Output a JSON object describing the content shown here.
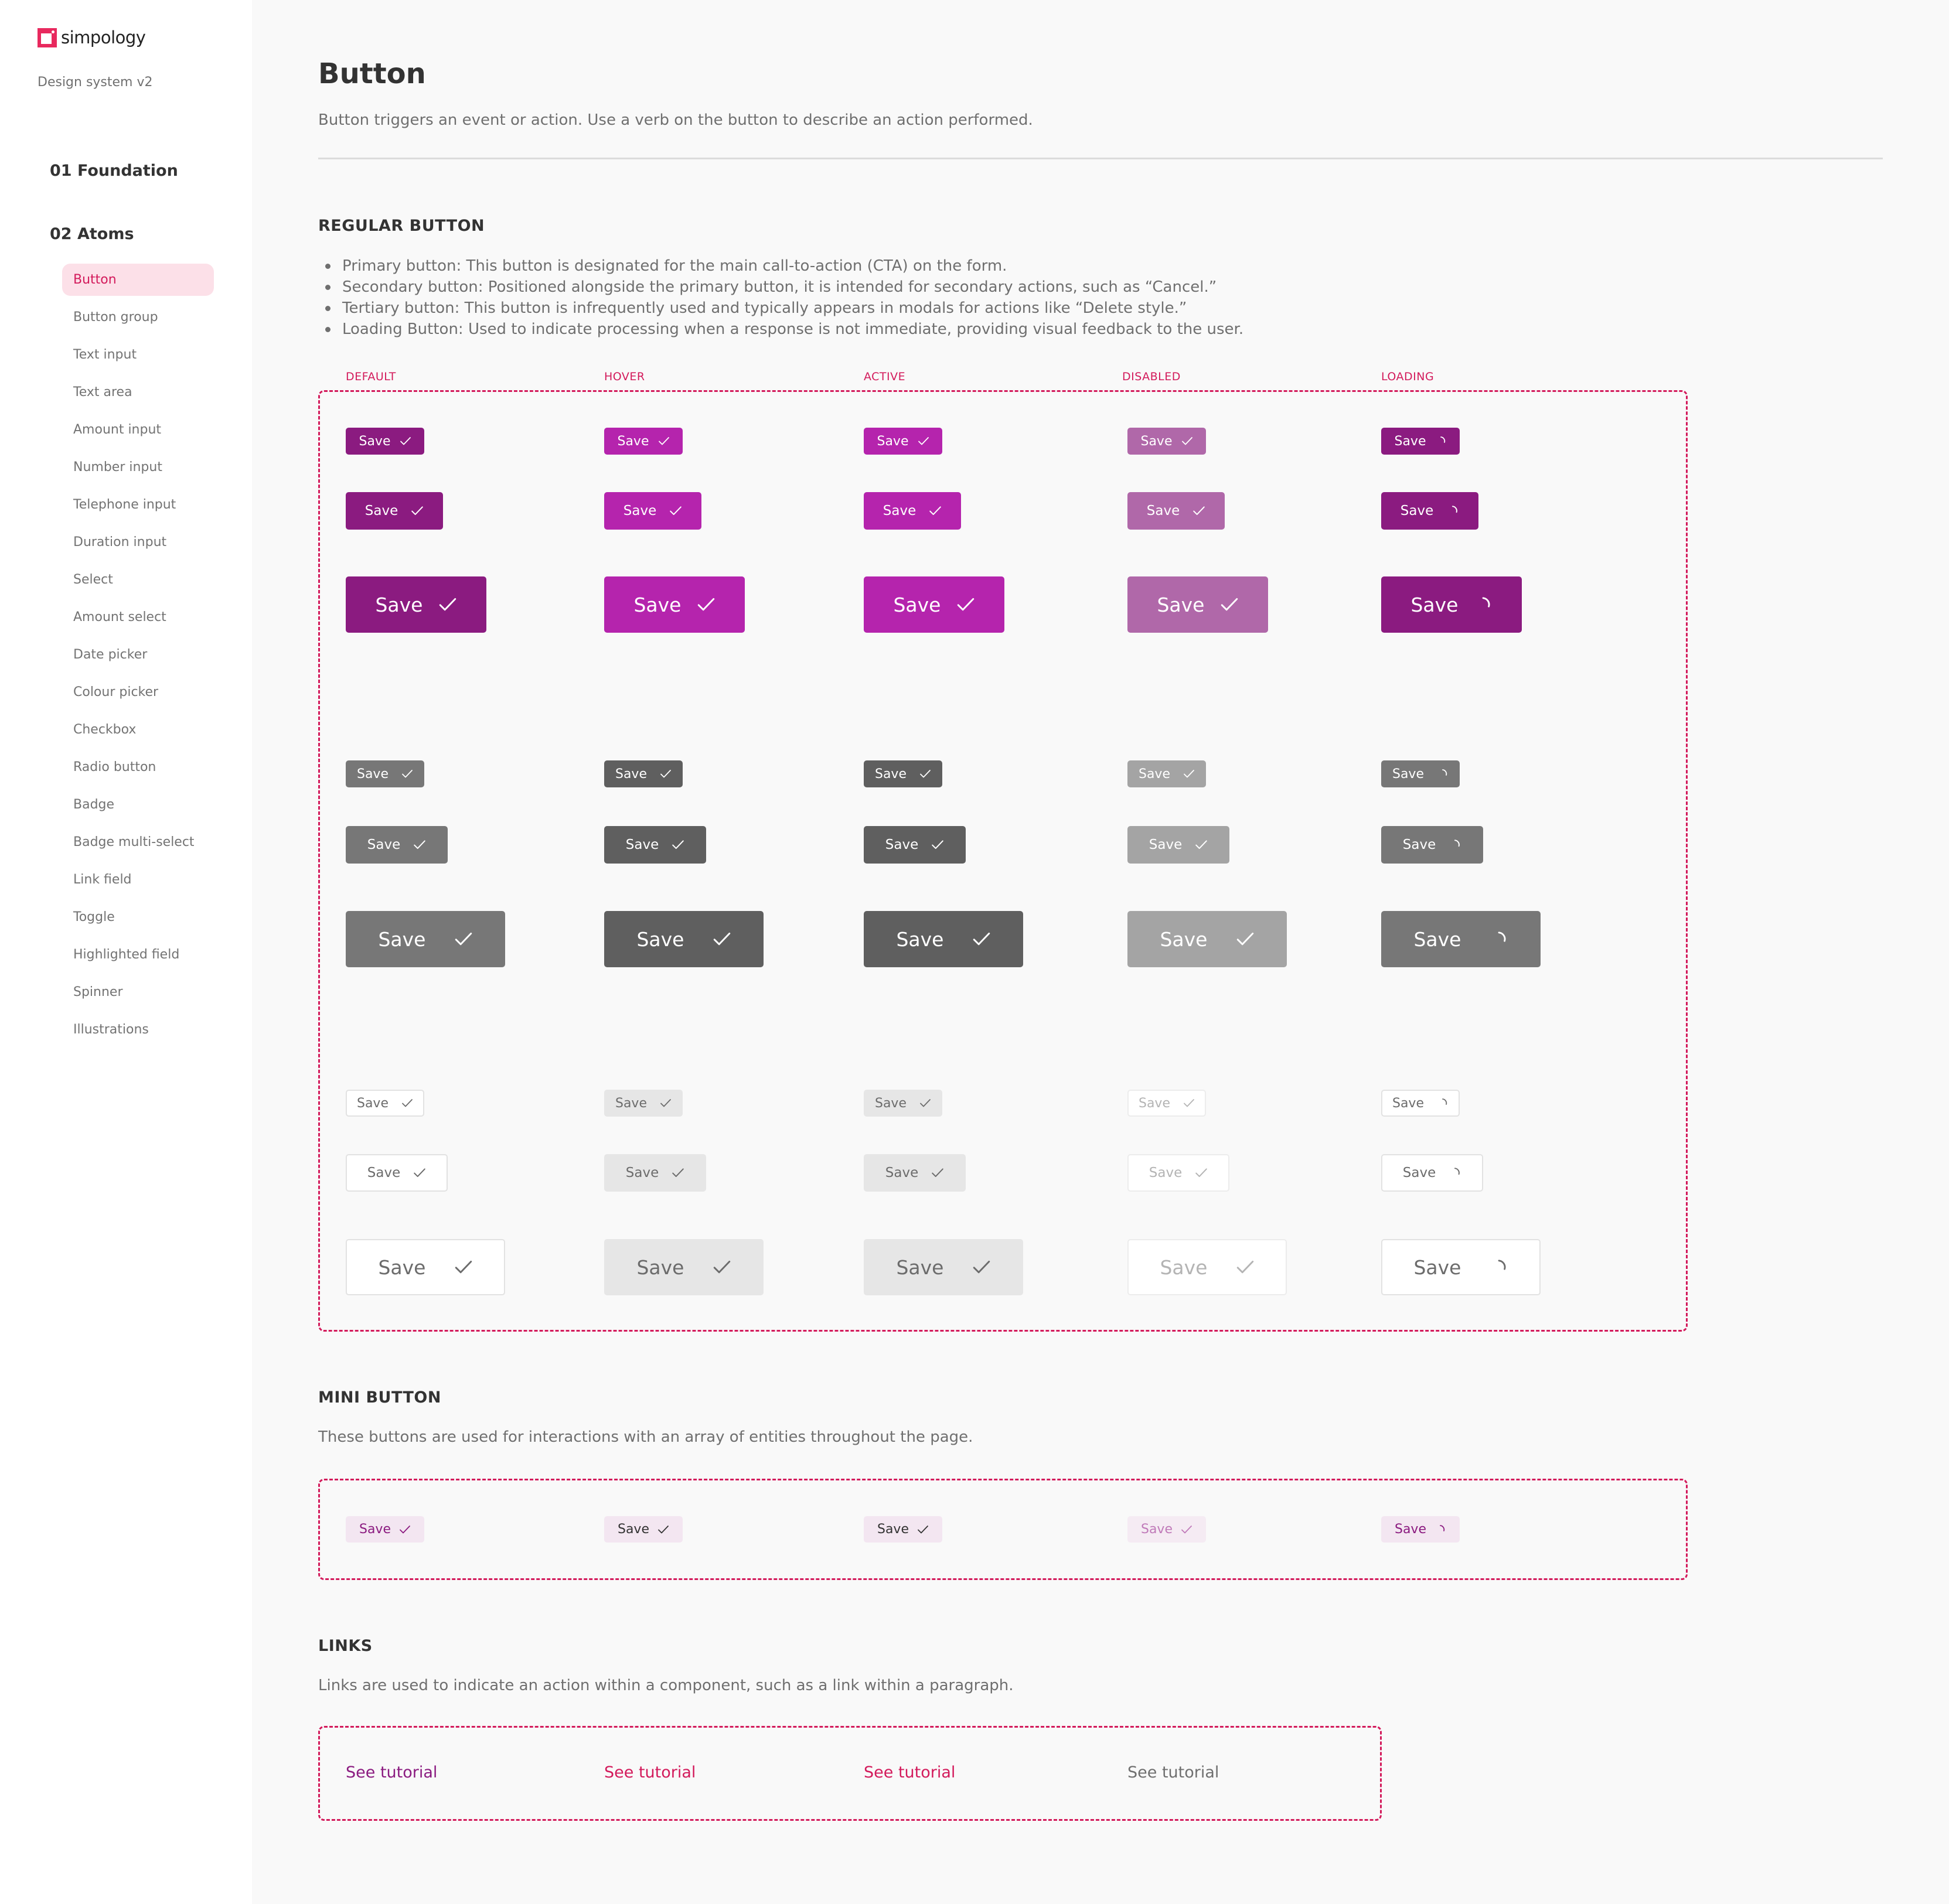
{
  "sidebar": {
    "brand": "simpology",
    "version": "Design system v2",
    "sections": [
      {
        "label": "01 Foundation"
      },
      {
        "label": "02 Atoms"
      }
    ],
    "items": [
      {
        "label": "Button",
        "active": true
      },
      {
        "label": "Button group"
      },
      {
        "label": "Text input"
      },
      {
        "label": "Text area"
      },
      {
        "label": "Amount input"
      },
      {
        "label": "Number input"
      },
      {
        "label": "Telephone input"
      },
      {
        "label": "Duration input"
      },
      {
        "label": "Select"
      },
      {
        "label": "Amount select"
      },
      {
        "label": "Date picker"
      },
      {
        "label": "Colour picker"
      },
      {
        "label": "Checkbox"
      },
      {
        "label": "Radio button"
      },
      {
        "label": "Badge"
      },
      {
        "label": "Badge multi-select"
      },
      {
        "label": "Link field"
      },
      {
        "label": "Toggle"
      },
      {
        "label": "Highlighted field"
      },
      {
        "label": "Spinner"
      },
      {
        "label": "Illustrations"
      }
    ]
  },
  "page": {
    "title": "Button",
    "description": "Button triggers an event or action. Use a verb on the button to describe an action performed."
  },
  "regular": {
    "title": "REGULAR BUTTON",
    "bullets": [
      "Primary button: This button is designated for the main call-to-action (CTA) on the form.",
      "Secondary button: Positioned alongside the primary button, it is intended for secondary actions, such as “Cancel.”",
      "Tertiary button: This button is infrequently used and typically appears in modals for actions like “Delete style.”",
      "Loading Button: Used to indicate processing when a response is not immediate, providing visual feedback to the user."
    ],
    "states": [
      "DEFAULT",
      "HOVER",
      "ACTIVE",
      "DISABLED",
      "LOADING"
    ],
    "button_label": "Save",
    "variants": [
      "primary",
      "secondary",
      "tertiary"
    ],
    "sizes": [
      "small",
      "medium",
      "large"
    ],
    "icons": {
      "default": "check-icon",
      "loading": "spinner-icon"
    }
  },
  "mini": {
    "title": "MINI BUTTON",
    "description": "These buttons are used for interactions with an array of entities throughout the page.",
    "button_label": "Save",
    "states": [
      "default",
      "hover",
      "active",
      "disabled",
      "loading"
    ]
  },
  "links": {
    "title": "LINKS",
    "description": "Links are used to indicate an action within a component, such as a link within a paragraph.",
    "items": [
      {
        "label": "See tutorial",
        "state": "default"
      },
      {
        "label": "See tutorial",
        "state": "hover"
      },
      {
        "label": "See tutorial",
        "state": "active"
      },
      {
        "label": "See tutorial",
        "state": "disabled"
      }
    ]
  },
  "colors": {
    "accent": "#d31a5b",
    "primary": "#8b1b80",
    "primary_hover": "#b524ad",
    "primary_disabled": "#b068a9",
    "secondary": "#777777",
    "secondary_hover": "#5f5f5f",
    "secondary_disabled": "#a4a4a4",
    "tertiary_hover": "#e6e6e6",
    "mini_bg": "#f3e6f1"
  }
}
